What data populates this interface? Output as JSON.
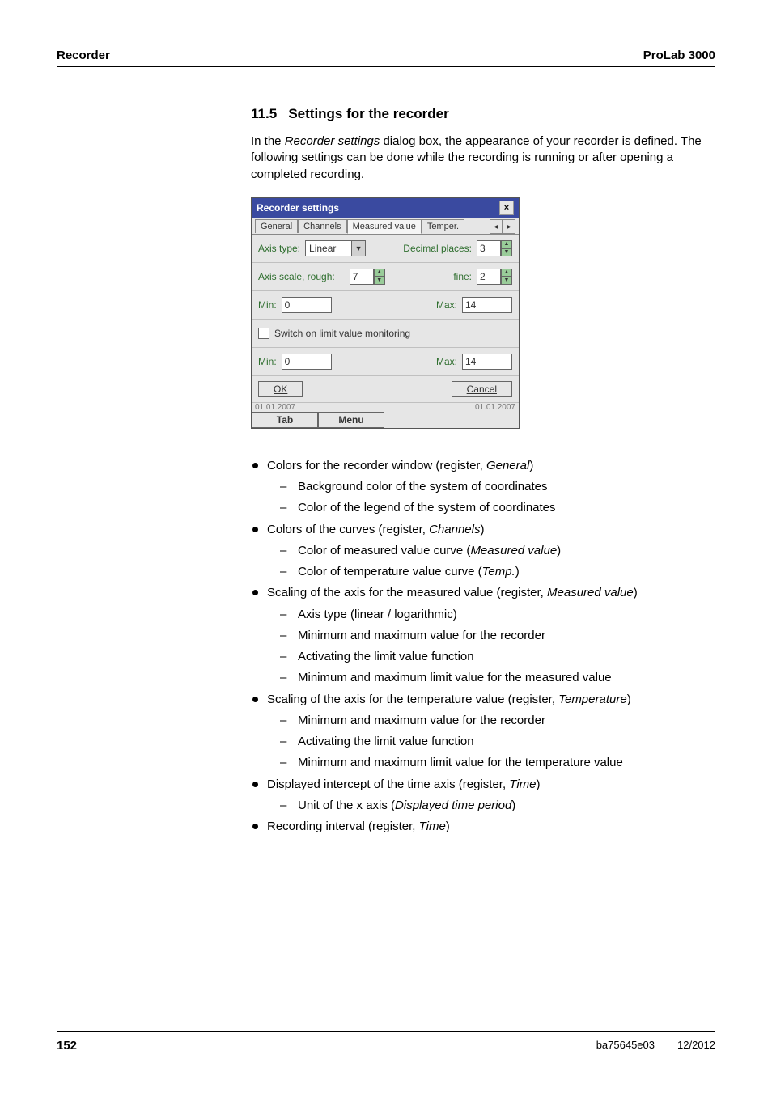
{
  "header": {
    "left": "Recorder",
    "right": "ProLab 3000"
  },
  "section": {
    "number": "11.5",
    "title": "Settings for the recorder"
  },
  "intro": {
    "part1": "In the ",
    "italic1": "Recorder settings",
    "part2": " dialog box, the appearance of your recorder is defined. The following settings can be done while the recording is running or after opening a completed recording."
  },
  "dialog": {
    "title": "Recorder settings",
    "close_glyph": "×",
    "tabs": [
      "General",
      "Channels",
      "Measured value",
      "Temper."
    ],
    "axis_type_label": "Axis type:",
    "axis_type_value": "Linear",
    "decimal_label": "Decimal places:",
    "decimal_value": "3",
    "scale_rough_label": "Axis scale, rough:",
    "scale_rough_value": "7",
    "fine_label": "fine:",
    "fine_value": "2",
    "min_label": "Min:",
    "max_label": "Max:",
    "min1": "0",
    "max1": "14",
    "limit_label": "Switch on limit value monitoring",
    "min2": "0",
    "max2": "14",
    "ok": "OK",
    "cancel": "Cancel",
    "status_left": "01.01.2007",
    "status_right": "01.01.2007",
    "soft_tab": "Tab",
    "soft_menu": "Menu"
  },
  "list": {
    "b1": {
      "t1": "Colors for the recorder window (register, ",
      "i1": "General",
      "t2": ")",
      "sub": [
        "Background color of the system of coordinates",
        "Color of the legend of the system of coordinates"
      ]
    },
    "b2": {
      "t1": "Colors of the curves (register, ",
      "i1": "Channels",
      "t2": ")",
      "sub0": {
        "t1": "Color of measured value curve (",
        "i1": "Measured value",
        "t2": ")"
      },
      "sub1": {
        "t1": "Color of temperature value curve (",
        "i1": "Temp.",
        "t2": ")"
      }
    },
    "b3": {
      "t1": "Scaling of the axis for the measured value (register, ",
      "i1": "Measured value",
      "t2": ")",
      "sub": [
        "Axis type (linear / logarithmic)",
        "Minimum and maximum value for the recorder",
        "Activating the limit value function",
        "Minimum and maximum limit value for the measured value"
      ]
    },
    "b4": {
      "t1": "Scaling of the axis for the temperature value (register, ",
      "i1": "Temperature",
      "t2": ")",
      "sub": [
        "Minimum and maximum value for the recorder",
        "Activating the limit value function",
        "Minimum and maximum limit value for the temperature value"
      ]
    },
    "b5": {
      "t1": "Displayed intercept of the time axis (register, ",
      "i1": "Time",
      "t2": ")",
      "sub0": {
        "t1": "Unit of the x axis (",
        "i1": "Displayed time period",
        "t2": ")"
      }
    },
    "b6": {
      "t1": "Recording interval (register, ",
      "i1": "Time",
      "t2": ")"
    }
  },
  "footer": {
    "page": "152",
    "docid": "ba75645e03",
    "date": "12/2012"
  }
}
